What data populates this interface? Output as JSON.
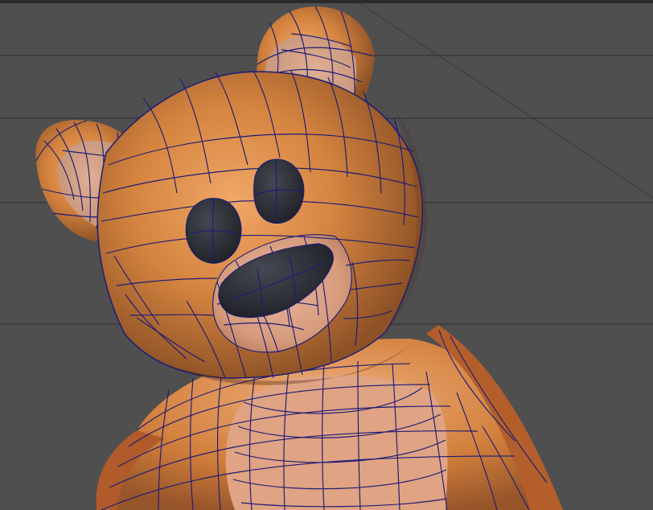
{
  "viewport": {
    "panel": "3d-perspective-viewport",
    "display_mode": "smooth-shaded-wireframe-on-shaded",
    "background_color": "#4f4f4f",
    "grid_color": "#343434"
  },
  "model": {
    "name_semantic": "teddy-bear-mesh",
    "primary_color": "#cb7a39",
    "muzzle_color": "#d99a79",
    "ear_inner_color": "#c89378",
    "wire_color": "#1c1c76",
    "feature_color": "#2f3036"
  }
}
